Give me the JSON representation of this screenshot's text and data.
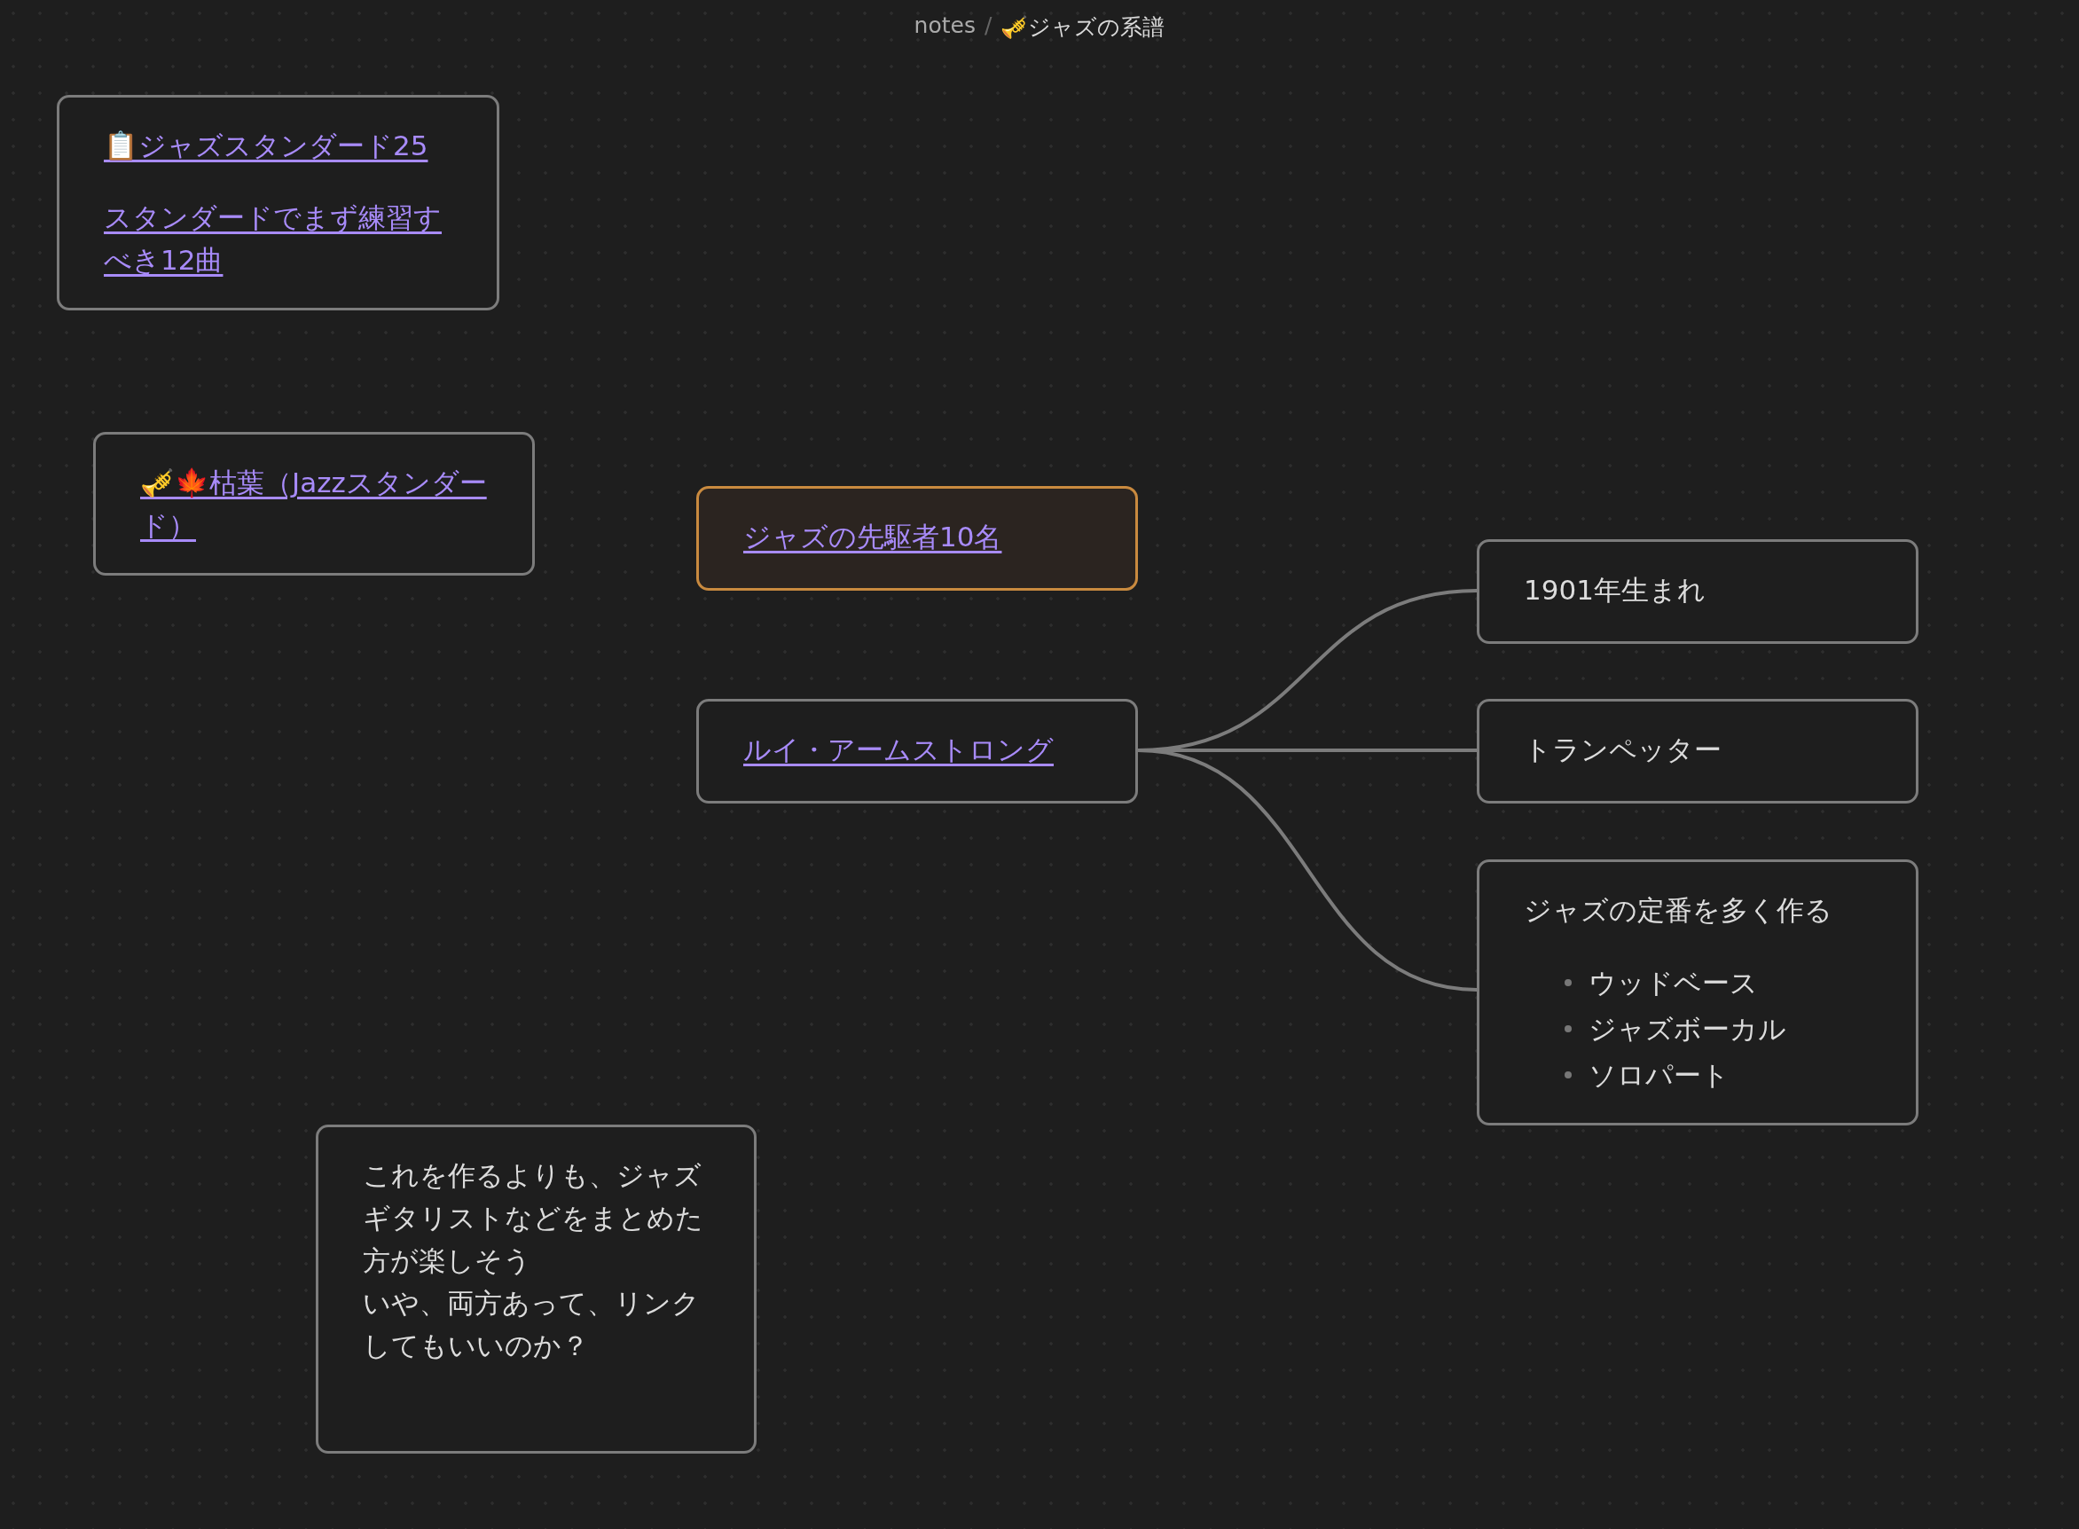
{
  "breadcrumb": {
    "folder": "notes",
    "separator": "/",
    "title": "🎺ジャズの系譜"
  },
  "nodes": [
    {
      "blocks": [
        {
          "kind": "link",
          "text": "📋ジャズスタンダード25"
        },
        {
          "kind": "link",
          "text": "スタンダードでまず練習すべき12曲"
        }
      ]
    },
    {
      "blocks": [
        {
          "kind": "link",
          "text": "🎺🍁枯葉（Jazzスタンダード）"
        }
      ]
    },
    {
      "color": "#c98a3f",
      "blocks": [
        {
          "kind": "link",
          "text": "ジャズの先駆者10名"
        }
      ]
    },
    {
      "blocks": [
        {
          "kind": "link",
          "text": "ルイ・アームストロング"
        }
      ]
    },
    {
      "blocks": [
        {
          "kind": "text",
          "text": "1901年生まれ"
        }
      ]
    },
    {
      "blocks": [
        {
          "kind": "text",
          "text": "トランペッター"
        }
      ]
    },
    {
      "blocks": [
        {
          "kind": "text",
          "text": "ジャズの定番を多く作る"
        },
        {
          "kind": "list",
          "items": [
            "ウッドベース",
            "ジャズボーカル",
            "ソロパート"
          ]
        }
      ]
    },
    {
      "blocks": [
        {
          "kind": "text",
          "text": "これを作るよりも、ジャズギタリストなどをまとめた方が楽しそう"
        },
        {
          "kind": "text",
          "text": "いや、両方あって、リンクしてもいいのか？"
        }
      ]
    }
  ]
}
